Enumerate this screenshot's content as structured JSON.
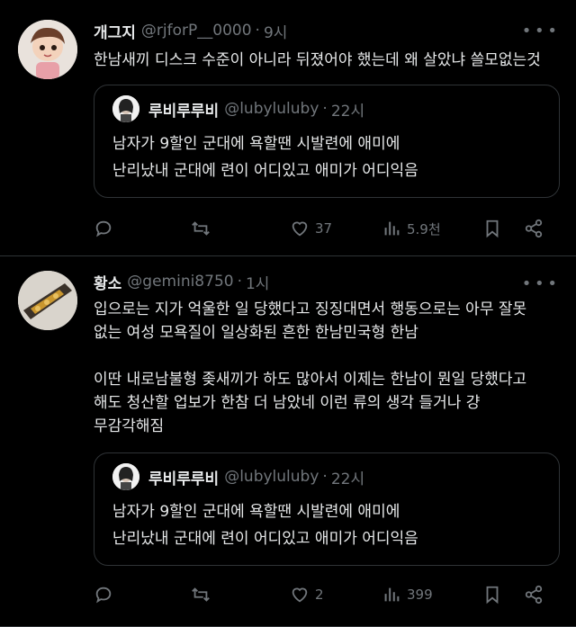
{
  "tweets": [
    {
      "name": "개그지",
      "handle": "@rjforP__0000",
      "dot": "·",
      "time": "9시",
      "text": "한남새끼 디스크 수준이 아니라 뒤졌어야 했는데 왜 살았냐 쓸모없는것",
      "quote": {
        "name": "루비루루비",
        "handle": "@lubyluluby",
        "dot": "·",
        "time": "22시",
        "text": "남자가 9할인 군대에 욕할땐 시발련에 애미에\n난리났내 군대에 련이 어디있고 애미가 어디익음"
      },
      "actions": {
        "reply": "",
        "retweet": "",
        "likes": "37",
        "views": "5.9천"
      }
    },
    {
      "name": "황소",
      "handle": "@gemini8750",
      "dot": "·",
      "time": "1시",
      "text": "입으로는 지가 억울한 일 당했다고 징징대면서 행동으로는 아무 잘못\n없는 여성 모욕질이 일상화된 흔한 한남민국형 한남\n\n이딴 내로남불형 좆새끼가 하도 많아서 이제는 한남이 뭔일 당했다고\n해도 청산할 업보가 한참 더 남았네 이런 류의 생각 들거나 걍\n무감각해짐",
      "quote": {
        "name": "루비루루비",
        "handle": "@lubyluluby",
        "dot": "·",
        "time": "22시",
        "text": "남자가 9할인 군대에 욕할땐 시발련에 애미에\n난리났내 군대에 련이 어디있고 애미가 어디익음"
      },
      "actions": {
        "reply": "",
        "retweet": "",
        "likes": "2",
        "views": "399"
      }
    }
  ],
  "more_icon": "more-icon"
}
